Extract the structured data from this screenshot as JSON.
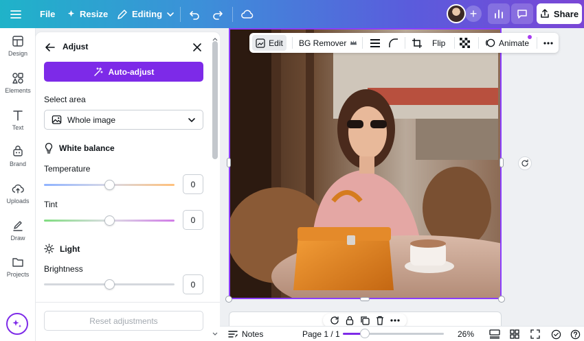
{
  "topbar": {
    "file_label": "File",
    "resize_label": "Resize",
    "editing_label": "Editing",
    "share_label": "Share"
  },
  "rail": {
    "items": [
      {
        "label": "Design",
        "icon": "layout-icon"
      },
      {
        "label": "Elements",
        "icon": "shapes-icon"
      },
      {
        "label": "Text",
        "icon": "text-icon"
      },
      {
        "label": "Brand",
        "icon": "brand-icon"
      },
      {
        "label": "Uploads",
        "icon": "cloud-upload-icon"
      },
      {
        "label": "Draw",
        "icon": "pen-icon"
      },
      {
        "label": "Projects",
        "icon": "folder-icon"
      }
    ]
  },
  "panel": {
    "title": "Adjust",
    "auto_adjust_label": "Auto-adjust",
    "select_area_label": "Select area",
    "select_area_value": "Whole image",
    "white_balance_label": "White balance",
    "temperature_label": "Temperature",
    "temperature_value": "0",
    "tint_label": "Tint",
    "tint_value": "0",
    "light_label": "Light",
    "brightness_label": "Brightness",
    "brightness_value": "0",
    "reset_label": "Reset adjustments"
  },
  "toolbar": {
    "edit_label": "Edit",
    "bg_remover_label": "BG Remover",
    "flip_label": "Flip",
    "animate_label": "Animate"
  },
  "bottombar": {
    "notes_label": "Notes",
    "page_label": "Page 1 / 1",
    "zoom_label": "26%",
    "zoom_level": 0.26
  },
  "colors": {
    "accent": "#7d2ae8",
    "selection": "#8b3dff"
  }
}
